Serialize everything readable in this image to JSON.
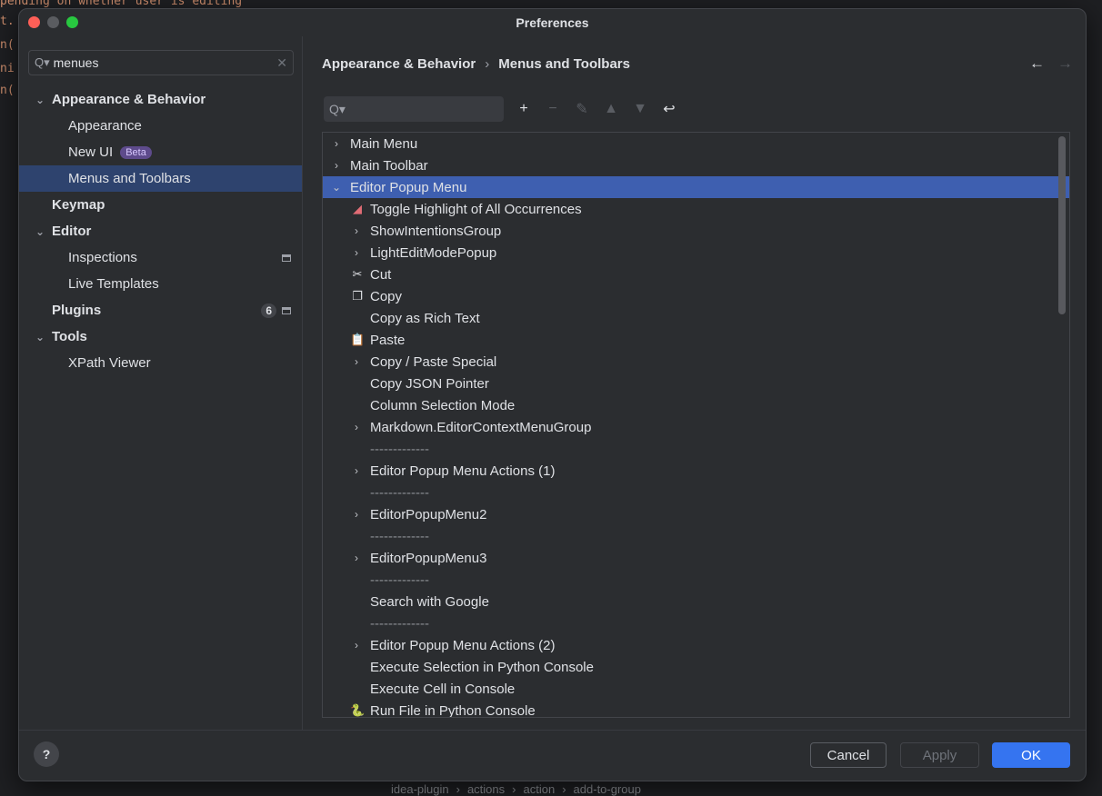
{
  "window": {
    "title": "Preferences"
  },
  "sidebar": {
    "search_value": "menues",
    "items": [
      {
        "label": "Appearance & Behavior",
        "level": 0,
        "bold": true,
        "expanded": true
      },
      {
        "label": "Appearance",
        "level": 1
      },
      {
        "label": "New UI",
        "level": 1,
        "badge": "Beta"
      },
      {
        "label": "Menus and Toolbars",
        "level": 1,
        "selected": true
      },
      {
        "label": "Keymap",
        "level": 0,
        "bold": true
      },
      {
        "label": "Editor",
        "level": 0,
        "bold": true,
        "expanded": true
      },
      {
        "label": "Inspections",
        "level": 1,
        "project_icon": true
      },
      {
        "label": "Live Templates",
        "level": 1
      },
      {
        "label": "Plugins",
        "level": 0,
        "bold": true,
        "count": "6",
        "project_icon": true
      },
      {
        "label": "Tools",
        "level": 0,
        "bold": true,
        "expanded": true
      },
      {
        "label": "XPath Viewer",
        "level": 1
      }
    ]
  },
  "main": {
    "breadcrumb": {
      "parent": "Appearance & Behavior",
      "sep": "›",
      "current": "Menus and Toolbars"
    },
    "nav": {
      "back": "←",
      "forward": "→"
    },
    "toolbar": {
      "search_value": ""
    },
    "actions": [
      {
        "label": "Main Menu",
        "level": 0,
        "chevron": "right"
      },
      {
        "label": "Main Toolbar",
        "level": 0,
        "chevron": "right"
      },
      {
        "label": "Editor Popup Menu",
        "level": 0,
        "chevron": "down",
        "selected": true
      },
      {
        "label": "Toggle Highlight of All Occurrences",
        "level": 1,
        "icon": "highlight"
      },
      {
        "label": "ShowIntentionsGroup",
        "level": 1,
        "chevron": "right"
      },
      {
        "label": "LightEditModePopup",
        "level": 1,
        "chevron": "right"
      },
      {
        "label": "Cut",
        "level": 1,
        "icon": "scissors"
      },
      {
        "label": "Copy",
        "level": 1,
        "icon": "copy"
      },
      {
        "label": "Copy as Rich Text",
        "level": 1
      },
      {
        "label": "Paste",
        "level": 1,
        "icon": "paste"
      },
      {
        "label": "Copy / Paste Special",
        "level": 1,
        "chevron": "right"
      },
      {
        "label": "Copy JSON Pointer",
        "level": 1
      },
      {
        "label": "Column Selection Mode",
        "level": 1
      },
      {
        "label": "Markdown.EditorContextMenuGroup",
        "level": 1,
        "chevron": "right"
      },
      {
        "label": "-------------",
        "level": 1,
        "separator": true
      },
      {
        "label": "Editor Popup Menu Actions (1)",
        "level": 1,
        "chevron": "right"
      },
      {
        "label": "-------------",
        "level": 1,
        "separator": true
      },
      {
        "label": "EditorPopupMenu2",
        "level": 1,
        "chevron": "right"
      },
      {
        "label": "-------------",
        "level": 1,
        "separator": true
      },
      {
        "label": "EditorPopupMenu3",
        "level": 1,
        "chevron": "right"
      },
      {
        "label": "-------------",
        "level": 1,
        "separator": true
      },
      {
        "label": "Search with Google",
        "level": 1
      },
      {
        "label": "-------------",
        "level": 1,
        "separator": true
      },
      {
        "label": "Editor Popup Menu Actions (2)",
        "level": 1,
        "chevron": "right"
      },
      {
        "label": "Execute Selection in Python Console",
        "level": 1
      },
      {
        "label": "Execute Cell in Console",
        "level": 1
      },
      {
        "label": "Run File in Python Console",
        "level": 1,
        "icon": "python"
      }
    ]
  },
  "footer": {
    "help": "?",
    "cancel": "Cancel",
    "apply": "Apply",
    "ok": "OK"
  },
  "background": {
    "left_code": [
      "pending on whether user is editing",
      "t.",
      "n(",
      "ni",
      "n("
    ],
    "statusbar": [
      "idea-plugin",
      "actions",
      "action",
      "add-to-group"
    ]
  },
  "colors": {
    "dialog_bg": "#2b2d30",
    "selection_sidebar": "#2e436e",
    "selection_list": "#3e5fb0",
    "ok_button": "#3574f0"
  }
}
